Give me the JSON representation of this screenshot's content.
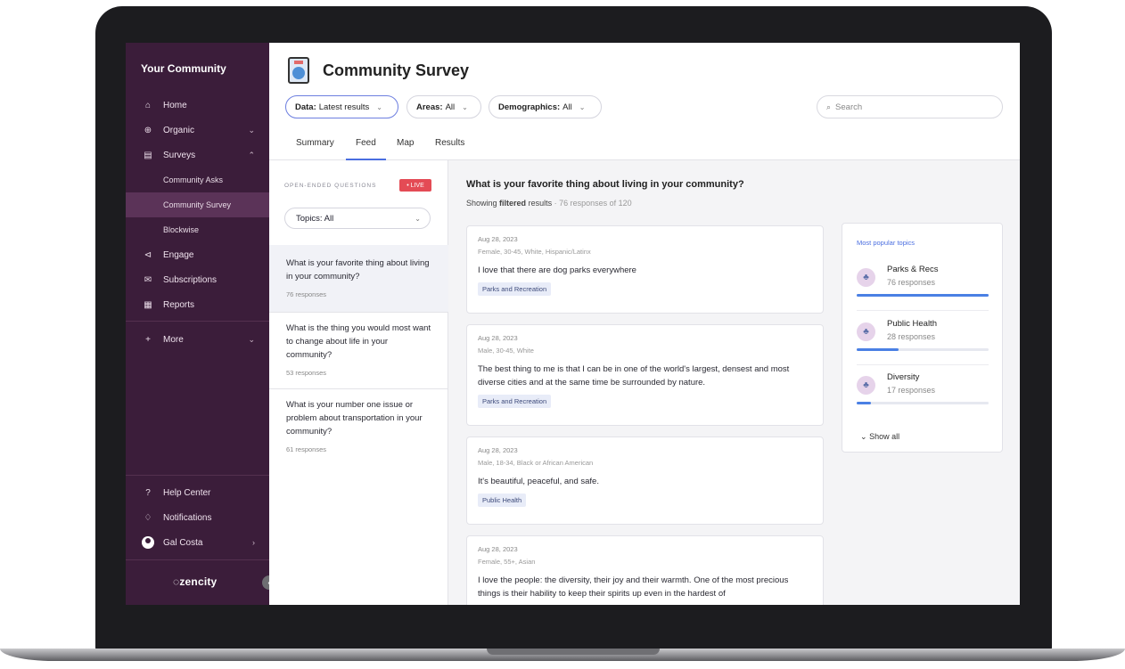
{
  "sidebar": {
    "title": "Your Community",
    "items": [
      {
        "label": "Home",
        "icon": "home-icon",
        "glyph": "⌂"
      },
      {
        "label": "Organic",
        "icon": "globe-icon",
        "glyph": "⊕",
        "chevron": "⌄"
      },
      {
        "label": "Surveys",
        "icon": "survey-icon",
        "glyph": "▤",
        "chevron": "⌃"
      },
      {
        "label": "Engage",
        "icon": "engage-icon",
        "glyph": "⊲"
      },
      {
        "label": "Subscriptions",
        "icon": "mail-icon",
        "glyph": "✉"
      },
      {
        "label": "Reports",
        "icon": "reports-icon",
        "glyph": "▦"
      },
      {
        "label": "More",
        "icon": "plus-icon",
        "glyph": "+",
        "chevron": "⌄"
      }
    ],
    "sub_items": [
      {
        "label": "Community Asks",
        "active": false
      },
      {
        "label": "Community Survey",
        "active": true
      },
      {
        "label": "Blockwise",
        "active": false
      }
    ],
    "bottom": {
      "help": "Help Center",
      "help_glyph": "?",
      "notifications": "Notifications",
      "notifications_glyph": "♢",
      "user": "Gal Costa",
      "user_chevron": "›"
    },
    "logo": "zencity",
    "collapse_glyph": "‹"
  },
  "header": {
    "title": "Community Survey",
    "filters": {
      "data": {
        "key": "Data:",
        "value": "Latest results"
      },
      "areas": {
        "key": "Areas:",
        "value": "All"
      },
      "demographics": {
        "key": "Demographics:",
        "value": "All"
      }
    },
    "search_placeholder": "Search",
    "tabs": [
      "Summary",
      "Feed",
      "Map",
      "Results"
    ],
    "active_tab": "Feed"
  },
  "questions_panel": {
    "label": "OPEN-ENDED QUESTIONS",
    "live": "• LIVE",
    "topics_filter": "Topics: All",
    "questions": [
      {
        "text": "What is your favorite thing about living in your community?",
        "responses": "76 responses"
      },
      {
        "text": "What is the thing you would most want to change about life in your community?",
        "responses": "53 responses"
      },
      {
        "text": "What is your number one issue or problem about transportation in your community?",
        "responses": "61 responses"
      }
    ]
  },
  "feed": {
    "question": "What is your favorite thing about living in your community?",
    "showing_prefix": "Showing",
    "showing_bold": "filtered",
    "showing_suffix": "results",
    "showing_count": "· 76 responses of 120",
    "cards": [
      {
        "date": "Aug 28, 2023",
        "meta": "Female, 30-45, White, Hispanic/Latinx",
        "text": "I love that there are dog parks everywhere",
        "tag": "Parks and Recreation"
      },
      {
        "date": "Aug 28, 2023",
        "meta": "Male, 30-45, White",
        "text": "The best thing to me is that I can be in one of the world's largest, densest and most diverse cities and at the same time be surrounded by nature.",
        "tag": "Parks and Recreation"
      },
      {
        "date": "Aug 28, 2023",
        "meta": "Male, 18-34, Black or African American",
        "text": "It's beautiful, peaceful, and safe.",
        "tag": "Public Health"
      },
      {
        "date": "Aug 28, 2023",
        "meta": "Female, 55+, Asian",
        "text": "I love the people: the diversity, their joy and their warmth. One of the most precious things is their hability to keep their spirits up even in the hardest of",
        "tag": ""
      }
    ]
  },
  "popular_topics": {
    "title": "Most popular topics",
    "topics": [
      {
        "name": "Parks & Recs",
        "responses": "76 responses",
        "share": 1.0
      },
      {
        "name": "Public Health",
        "responses": "28 responses",
        "share": 0.32
      },
      {
        "name": "Diversity",
        "responses": "17 responses",
        "share": 0.11
      }
    ],
    "show_all": "Show all"
  },
  "colors": {
    "sidebar_bg": "#3b1d3a",
    "accent": "#4a6ee0",
    "live_badge": "#e44b55"
  }
}
